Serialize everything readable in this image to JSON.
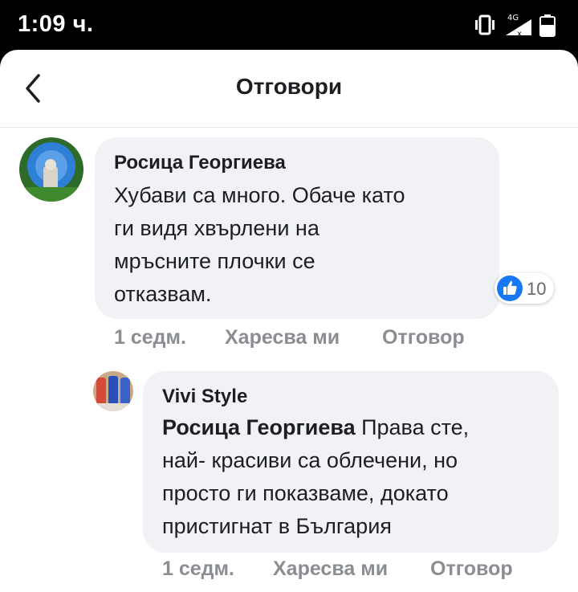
{
  "status": {
    "time": "1:09 ч.",
    "network": "4G"
  },
  "header": {
    "title": "Отговори"
  },
  "comment": {
    "author": "Росица Георгиева",
    "lines": [
      "Хубави са много. Обаче като",
      "ги видя хвърлени на",
      "мръсните плочки се",
      "отказвам."
    ],
    "reaction_count": "10",
    "time": "1 седм.",
    "like_label": "Харесва ми",
    "reply_label": "Отговор"
  },
  "reply": {
    "author": "Vivi Style",
    "mention": "Росица Георгиева",
    "line1_rest": " Права сте,",
    "lines": [
      "най- красиви са облечени, но",
      "просто ги показваме, докато",
      "пристигнат в България"
    ],
    "time": "1 седм.",
    "like_label": "Харесва ми",
    "reply_label": "Отговор"
  },
  "colors": {
    "bubble": "#f0f2f5",
    "like_blue": "#1877f2",
    "meta_gray": "#8a8d91"
  }
}
